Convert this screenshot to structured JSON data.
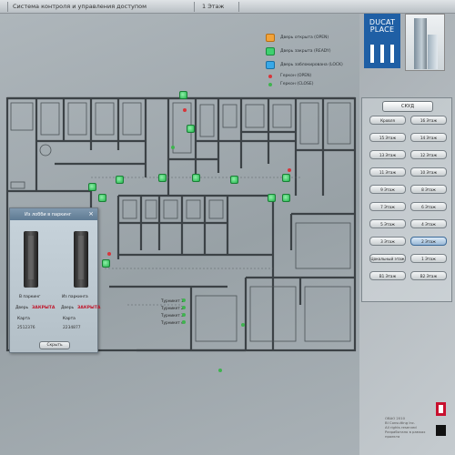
{
  "app": {
    "title": "Система контроля и управления доступом",
    "floor_title": "1 Этаж"
  },
  "legend": [
    {
      "label": "Дверь открыта (OPEN)",
      "color": "#f2a33a",
      "kind": "swatch"
    },
    {
      "label": "Дверь закрыта (READY)",
      "color": "#3fd070",
      "kind": "swatch"
    },
    {
      "label": "Дверь заблокирована (LOCK)",
      "color": "#38a8e8",
      "kind": "swatch"
    },
    {
      "label": "Геркон (OPEN)",
      "color": "#d8353a",
      "kind": "dot"
    },
    {
      "label": "Геркон (CLOSE)",
      "color": "#3fb34f",
      "kind": "dot"
    }
  ],
  "map": {
    "turnstiles": [
      "Турникет 1",
      "Турникет 2",
      "Турникет 3",
      "Турникет 4"
    ]
  },
  "popup": {
    "title": "Из лобби в паркинг",
    "close_icon": "close-icon",
    "left": {
      "heading": "В паркинг",
      "door_label": "Дверь",
      "door_status": "ЗАКРЫТА",
      "card_label": "Карта",
      "card_value": "2512376"
    },
    "right": {
      "heading": "Из паркинга",
      "door_label": "Дверь",
      "door_status": "ЗАКРЫТА",
      "card_label": "Карта",
      "card_value": "2234877"
    },
    "button_label": "Скрыть"
  },
  "sidebar": {
    "logo_text": [
      "DUCAT",
      "PLACE"
    ],
    "section_header": "СКУД",
    "floors": [
      [
        "Кровля",
        "16 Этаж"
      ],
      [
        "15 Этаж",
        "14 Этаж"
      ],
      [
        "13 Этаж",
        "12 Этаж"
      ],
      [
        "11 Этаж",
        "10 Этаж"
      ],
      [
        "9 Этаж",
        "8 Этаж"
      ],
      [
        "7 Этаж",
        "6 Этаж"
      ],
      [
        "5 Этаж",
        "4 Этаж"
      ],
      [
        "3 Этаж",
        "2 Этаж"
      ],
      [
        "Цокольный этаж",
        "1 Этаж"
      ],
      [
        "B1 Этаж",
        "B2 Этаж"
      ]
    ],
    "active_floor": "1 Этаж",
    "copyright": [
      "ОВАО 2010",
      "BI Consulting Inc.",
      "All rights reserved",
      "Разработано в рамках проекта"
    ]
  },
  "colors": {
    "door_ready": "#3fd070",
    "sensor_open": "#d8353a",
    "sensor_close": "#3fb34f",
    "accent_blue": "#1f5fa5"
  }
}
